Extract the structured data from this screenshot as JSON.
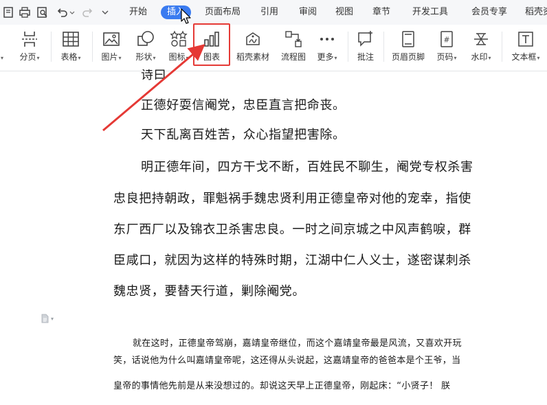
{
  "menubar": {
    "tabs": [
      {
        "label": "开始",
        "active": false
      },
      {
        "label": "插入",
        "active": true
      },
      {
        "label": "页面布局",
        "active": false
      },
      {
        "label": "引用",
        "active": false
      },
      {
        "label": "审阅",
        "active": false
      },
      {
        "label": "视图",
        "active": false
      },
      {
        "label": "章节",
        "active": false
      },
      {
        "label": "开发工具",
        "active": false
      },
      {
        "label": "会员专享",
        "active": false
      },
      {
        "label": "稻壳资",
        "active": false
      }
    ]
  },
  "ribbon": {
    "items": [
      {
        "label": "分页",
        "icon": "page-break-icon",
        "dropdown": true
      },
      {
        "label": "表格",
        "icon": "table-icon",
        "dropdown": true
      },
      {
        "label": "图片",
        "icon": "picture-icon",
        "dropdown": true
      },
      {
        "label": "形状",
        "icon": "shape-icon",
        "dropdown": true
      },
      {
        "label": "图标",
        "icon": "icon-library-icon",
        "dropdown": true
      },
      {
        "label": "图表",
        "icon": "chart-icon",
        "dropdown": false
      },
      {
        "label": "稻壳素材",
        "icon": "material-icon",
        "dropdown": false
      },
      {
        "label": "流程图",
        "icon": "flowchart-icon",
        "dropdown": false
      },
      {
        "label": "更多",
        "icon": "more-icon",
        "dropdown": true
      },
      {
        "label": "批注",
        "icon": "comment-icon",
        "dropdown": false
      },
      {
        "label": "页眉页脚",
        "icon": "header-footer-icon",
        "dropdown": false
      },
      {
        "label": "页码",
        "icon": "page-number-icon",
        "dropdown": true
      },
      {
        "label": "水印",
        "icon": "watermark-icon",
        "dropdown": true
      },
      {
        "label": "文本框",
        "icon": "textbox-icon",
        "dropdown": true
      }
    ],
    "highlight_color": "#e53935",
    "accent_color": "#3a7bf0"
  },
  "document": {
    "poem_lines": [
      "正德好耍信阉党，忠臣直言把命丧。",
      "天下乱离百姓苦，众心指望把害除。"
    ],
    "para1_lines": [
      "明正德年间，四方干戈不断，百姓民不聊生，阉党专权杀害",
      "忠良把持朝政，罪魁祸手魏忠贤利用正德皇帝对他的宠幸，指使",
      "东厂西厂以及锦衣卫杀害忠良。一时之间京城之中风声鹤唳，群",
      "臣咸口，就因为这样的特殊时期，江湖中仁人义士，遂密谋刺杀",
      "魏忠贤，要替天行道，剿除阉党。"
    ],
    "para2_lines": [
      "就在这时，正德皇帝驾崩，嘉靖皇帝继位，而这个嘉靖皇帝最是风流，又喜欢开玩",
      "笑，话说他为什么叫嘉靖皇帝呢，这还得从头说起，这嘉靖皇帝的爸爸本是个王爷，当",
      "皇帝的事情他先前是从来没想过的。却说这天早上正德皇帝，刚起床：“小贤子！ 朕"
    ]
  }
}
